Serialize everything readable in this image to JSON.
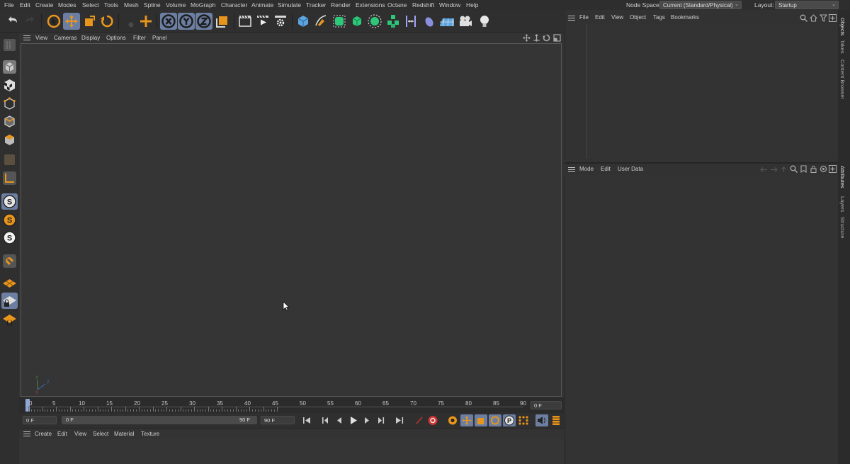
{
  "menu": {
    "items": [
      "File",
      "Edit",
      "Create",
      "Modes",
      "Select",
      "Tools",
      "Mesh",
      "Spline",
      "Volume",
      "MoGraph",
      "Character",
      "Animate",
      "Simulate",
      "Tracker",
      "Render",
      "Extensions",
      "Octane",
      "Redshift",
      "Window",
      "Help"
    ],
    "node_space_label": "Node Space:",
    "node_space_value": "Current (Standard/Physical)",
    "layout_label": "Layout:",
    "layout_value": "Startup"
  },
  "toolbar": {
    "icons": [
      "undo-icon",
      "redo-icon",
      "live-selection-icon",
      "move-icon",
      "scale-icon",
      "rotate-icon",
      "recent-tools-icon",
      "create-icon",
      "x-axis-lock-icon",
      "y-axis-lock-icon",
      "z-axis-lock-icon",
      "coordinate-system-icon",
      "render-region-icon",
      "render-view-icon",
      "render-settings-icon",
      "cube-icon",
      "pen-icon",
      "subdivision-icon",
      "extrude-icon",
      "cloner-icon",
      "deformer-icon",
      "symmetry-icon",
      "field-icon",
      "floor-icon",
      "camera-icon",
      "light-icon"
    ]
  },
  "viewport": {
    "menu": [
      "View",
      "Cameras",
      "Display",
      "Options",
      "Filter",
      "Panel"
    ],
    "axis_labels": {
      "y": "Y",
      "z": "Z",
      "x": "X"
    }
  },
  "timeline": {
    "ticks": [
      "0",
      "5",
      "10",
      "15",
      "20",
      "25",
      "30",
      "35",
      "40",
      "45",
      "50",
      "55",
      "60",
      "65",
      "70",
      "75",
      "80",
      "85",
      "90"
    ],
    "current_frame_field": "0 F",
    "start_field": "0 F",
    "range_start": "0 F",
    "range_end": "90 F",
    "end_field": "90 F"
  },
  "material_manager": {
    "menu": [
      "Create",
      "Edit",
      "View",
      "Select",
      "Material",
      "Texture"
    ]
  },
  "object_manager": {
    "menu": [
      "File",
      "Edit",
      "View",
      "Object",
      "Tags",
      "Bookmarks"
    ]
  },
  "attribute_manager": {
    "menu": [
      "Mode",
      "Edit",
      "User Data"
    ]
  },
  "right_tabs": {
    "top": [
      "Objects",
      "Takes",
      "Content Browser"
    ],
    "bottom": [
      "Attributes",
      "Layers",
      "Structure"
    ]
  },
  "colors": {
    "active_tool": "#6c7fa3",
    "orange": "#e8951c",
    "green": "#2dc87a",
    "panel_bg": "#333333"
  }
}
